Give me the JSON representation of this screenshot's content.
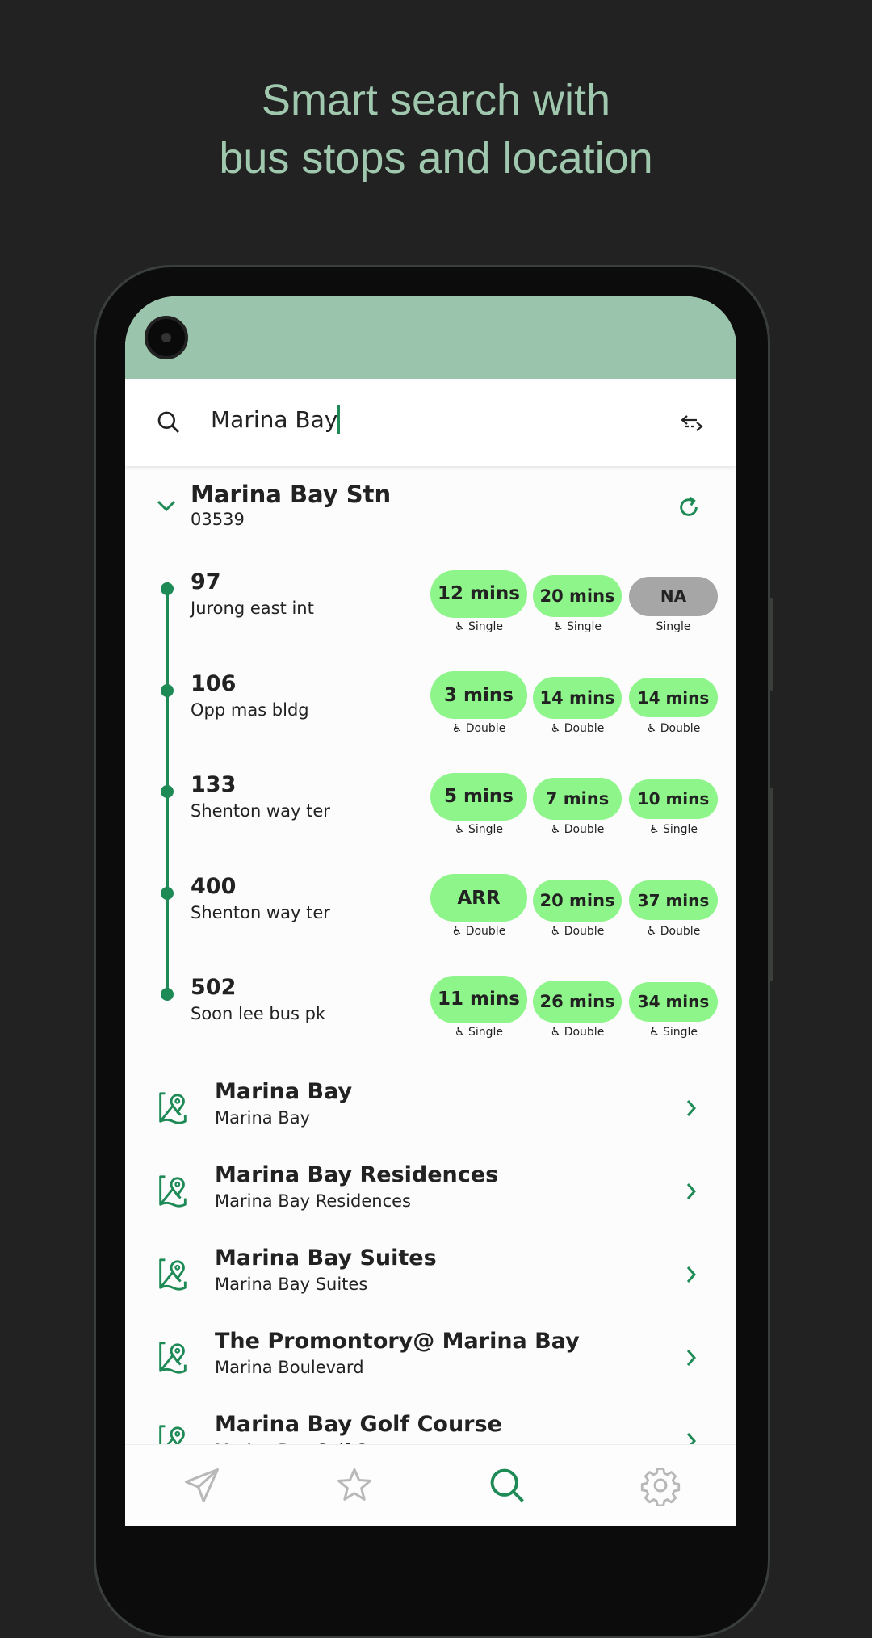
{
  "headline": {
    "line1": "Smart search with",
    "line2": "bus stops and location"
  },
  "colors": {
    "accent": "#1e8a55",
    "pill": "#8ef58a",
    "na": "#a6a6a6",
    "status_bar": "#9bc4ad",
    "headline": "#9fc8ae"
  },
  "search": {
    "value": "Marina Bay",
    "icon": "search-icon",
    "swap_icon": "swap-icon"
  },
  "stop": {
    "name": "Marina Bay Stn",
    "code": "03539",
    "expand_icon": "chevron-down-icon",
    "refresh_icon": "refresh-icon"
  },
  "services": [
    {
      "number": "97",
      "destination": "Jurong east int",
      "arrivals": [
        {
          "time": "12 mins",
          "type": "Single",
          "wheelchair": true
        },
        {
          "time": "20 mins",
          "type": "Single",
          "wheelchair": true
        },
        {
          "time": "NA",
          "type": "Single",
          "wheelchair": false
        }
      ]
    },
    {
      "number": "106",
      "destination": "Opp mas bldg",
      "arrivals": [
        {
          "time": "3 mins",
          "type": "Double",
          "wheelchair": true
        },
        {
          "time": "14 mins",
          "type": "Double",
          "wheelchair": true
        },
        {
          "time": "14 mins",
          "type": "Double",
          "wheelchair": true
        }
      ]
    },
    {
      "number": "133",
      "destination": "Shenton way ter",
      "arrivals": [
        {
          "time": "5 mins",
          "type": "Single",
          "wheelchair": true
        },
        {
          "time": "7 mins",
          "type": "Double",
          "wheelchair": true
        },
        {
          "time": "10 mins",
          "type": "Single",
          "wheelchair": true
        }
      ]
    },
    {
      "number": "400",
      "destination": "Shenton way ter",
      "arrivals": [
        {
          "time": "ARR",
          "type": "Double",
          "wheelchair": true
        },
        {
          "time": "20 mins",
          "type": "Double",
          "wheelchair": true
        },
        {
          "time": "37 mins",
          "type": "Double",
          "wheelchair": true
        }
      ]
    },
    {
      "number": "502",
      "destination": "Soon lee bus pk",
      "arrivals": [
        {
          "time": "11 mins",
          "type": "Single",
          "wheelchair": true
        },
        {
          "time": "26 mins",
          "type": "Double",
          "wheelchair": true
        },
        {
          "time": "34 mins",
          "type": "Single",
          "wheelchair": true
        }
      ]
    }
  ],
  "places": [
    {
      "title": "Marina Bay",
      "subtitle": "Marina Bay"
    },
    {
      "title": "Marina Bay Residences",
      "subtitle": "Marina Bay Residences"
    },
    {
      "title": "Marina Bay Suites",
      "subtitle": "Marina Bay Suites"
    },
    {
      "title": "The Promontory@ Marina Bay",
      "subtitle": "Marina Boulevard"
    },
    {
      "title": "Marina Bay Golf Course",
      "subtitle": "Marina Bay Golf Course"
    }
  ],
  "nav": [
    {
      "icon": "send-icon",
      "active": false
    },
    {
      "icon": "star-icon",
      "active": false
    },
    {
      "icon": "search-icon",
      "active": true
    },
    {
      "icon": "gear-icon",
      "active": false
    }
  ]
}
